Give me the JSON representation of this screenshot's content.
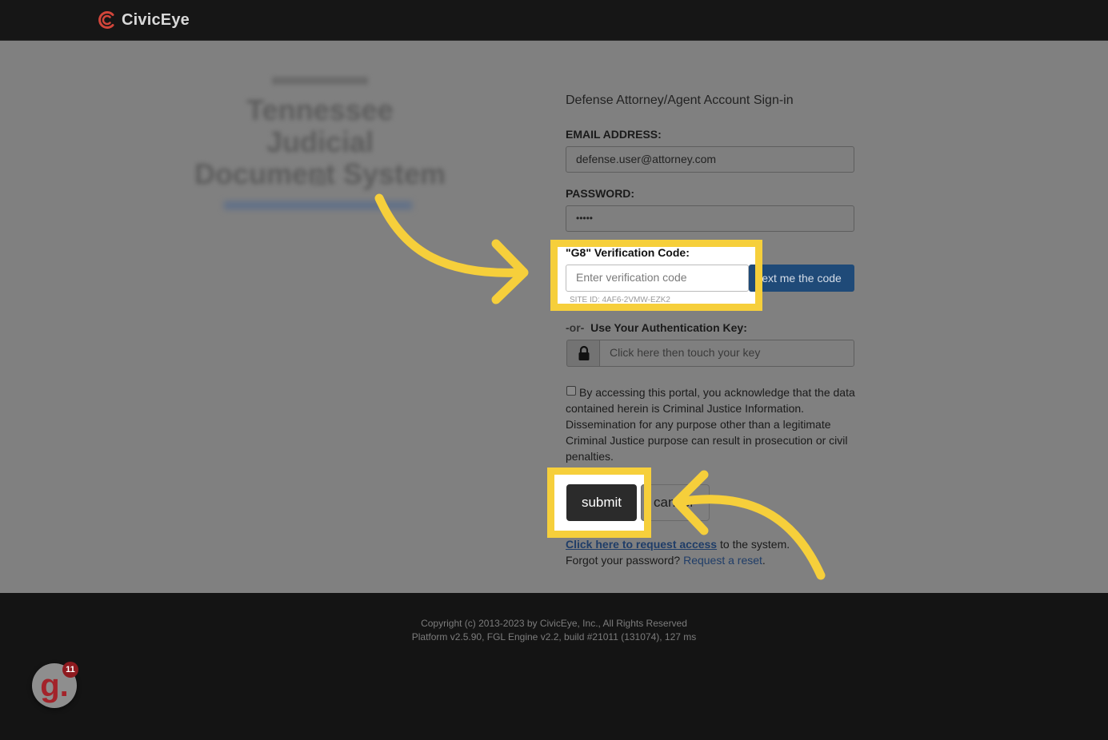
{
  "header": {
    "brand": "CivicEye"
  },
  "left_panel": {
    "title_line1": "Tennessee Judicial",
    "title_line2": "Document System"
  },
  "form": {
    "heading": "Defense Attorney/Agent Account Sign-in",
    "email_label": "EMAIL ADDRESS:",
    "email_value": "defense.user@attorney.com",
    "password_label": "PASSWORD:",
    "password_value": "•••••",
    "verification_label": "\"G8\" Verification Code:",
    "verification_placeholder": "Enter verification code",
    "sms_button": "ext me the code",
    "site_id": "SITE ID: 4AF6-2VMW-EZK2",
    "or_text": "-or-",
    "auth_key_label": "Use Your Authentication Key:",
    "auth_key_placeholder": "Click here then touch your key",
    "terms": "By accessing this portal, you acknowledge that the data contained herein is Criminal Justice Information. Dissemination for any purpose other than a legitimate Criminal Justice purpose can result in prosecution or civil penalties.",
    "submit_label": "submit",
    "cancel_label": "cancel",
    "access_link": "Click here to request access",
    "access_suffix": " to the system.",
    "forgot_prefix": "Forgot your password? ",
    "reset_link": "Request a reset",
    "forgot_suffix": "."
  },
  "footer": {
    "copyright": "Copyright (c) 2013-2023 by CivicEye, Inc., All Rights Reserved",
    "platform": "Platform v2.5.90, FGL Engine v2.2, build #21011 (131074), 127 ms"
  },
  "badge": {
    "letter": "g.",
    "count": "11"
  },
  "colors": {
    "highlight": "#f6cf3b",
    "brand_red": "#d2453a",
    "link": "#1f3d68"
  }
}
